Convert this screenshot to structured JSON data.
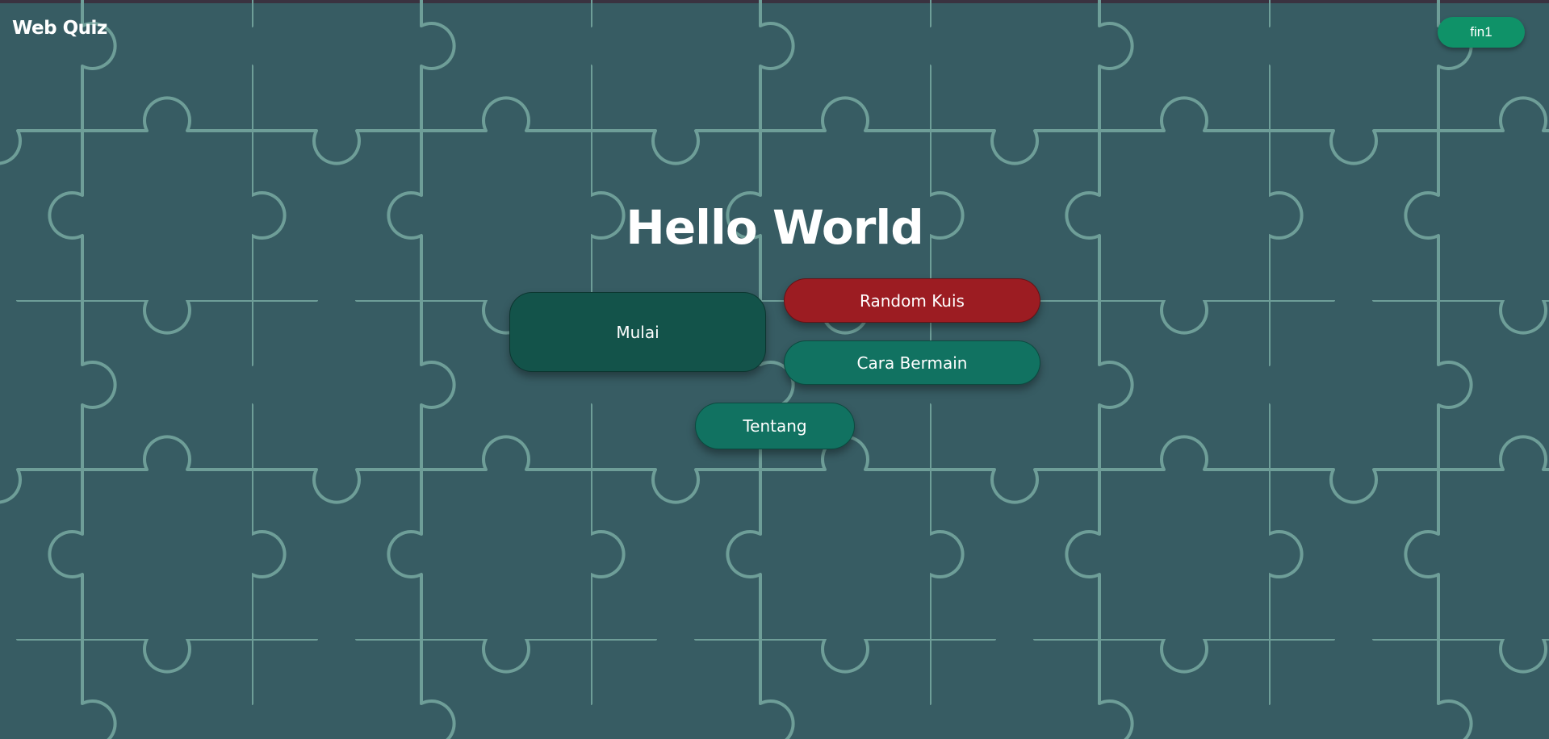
{
  "header": {
    "brand": "Web Quiz",
    "user_label": "fin1"
  },
  "hero": {
    "title": "Hello World"
  },
  "menu": {
    "start_label": "Mulai",
    "random_label": "Random Kuis",
    "howto_label": "Cara Bermain",
    "about_label": "Tentang"
  },
  "colors": {
    "background": "#375c63",
    "pattern_line": "#6e9e98",
    "start_button": "#13534a",
    "random_button": "#9c1c22",
    "howto_button": "#117261",
    "about_button": "#117261",
    "user_button": "#0f9268"
  },
  "icons": {
    "background": "puzzle-pattern"
  }
}
